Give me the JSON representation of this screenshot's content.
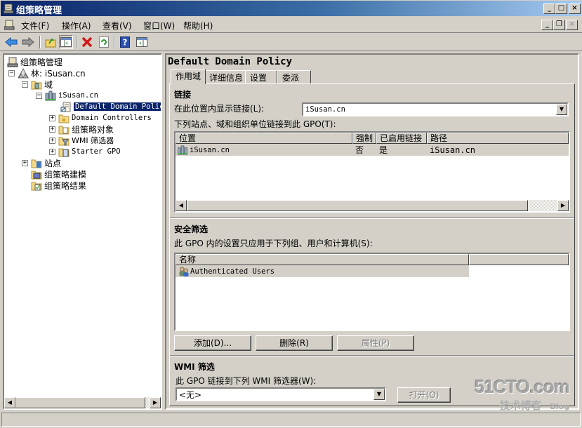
{
  "window": {
    "title": "组策略管理",
    "controls": {
      "minimize": "_",
      "maximize": "□",
      "close": "×"
    },
    "mdi_controls": {
      "minimize": "_",
      "restore": "❐",
      "close": "×"
    }
  },
  "menu": {
    "items": [
      {
        "label": "文件(F)"
      },
      {
        "label": "操作(A)"
      },
      {
        "label": "查看(V)"
      },
      {
        "label": "窗口(W)"
      },
      {
        "label": "帮助(H)"
      }
    ]
  },
  "toolbar": {
    "buttons": [
      "back-icon",
      "forward-icon",
      "up-folder-icon",
      "show-hide-tree-icon",
      "delete-icon",
      "refresh-icon",
      "help-icon",
      "show-action-pane-icon"
    ]
  },
  "tree": {
    "root": "组策略管理",
    "forest": "林: iSusan.cn",
    "domains": "域",
    "domain": "iSusan.cn",
    "selected": "Default Domain Policy",
    "children": [
      {
        "label": "Domain Controllers",
        "icon": "ou-folder-icon"
      },
      {
        "label": "组策略对象",
        "icon": "gpo-folder-icon"
      },
      {
        "label": "WMI 筛选器",
        "icon": "wmi-filter-folder-icon"
      },
      {
        "label": "Starter GPO",
        "icon": "starter-gpo-folder-icon"
      }
    ],
    "sites": "站点",
    "modeling": "组策略建模",
    "results": "组策略结果"
  },
  "details": {
    "title": "Default Domain Policy",
    "tabs": [
      {
        "label": "作用域",
        "active": true
      },
      {
        "label": "详细信息",
        "active": false
      },
      {
        "label": "设置",
        "active": false
      },
      {
        "label": "委派",
        "active": false
      }
    ],
    "links": {
      "section_title": "链接",
      "location_label": "在此位置内显示链接(L):",
      "location_value": "iSusan.cn",
      "list_label": "下列站点、域和组织单位链接到此 GPO(T):",
      "columns": [
        "位置",
        "强制",
        "已启用链接",
        "路径"
      ],
      "rows": [
        {
          "location": "iSusan.cn",
          "enforced": "否",
          "link_enabled": "是",
          "path": "iSusan.cn"
        }
      ]
    },
    "security": {
      "section_title": "安全筛选",
      "description": "此 GPO 内的设置只应用于下列组、用户和计算机(S):",
      "columns": [
        "名称",
        ""
      ],
      "rows": [
        {
          "name": "Authenticated Users"
        }
      ],
      "buttons": {
        "add": "添加(D)...",
        "remove": "删除(R)",
        "properties": "属性(P)"
      }
    },
    "wmi": {
      "section_title": "WMI 筛选",
      "description": "此 GPO 链接到下列 WMI 筛选器(W):",
      "value": "<无>",
      "open_button": "打开(O)"
    }
  },
  "watermark": {
    "site": "51CTO.com",
    "tagline": "技术博客",
    "blog": "Blog"
  }
}
